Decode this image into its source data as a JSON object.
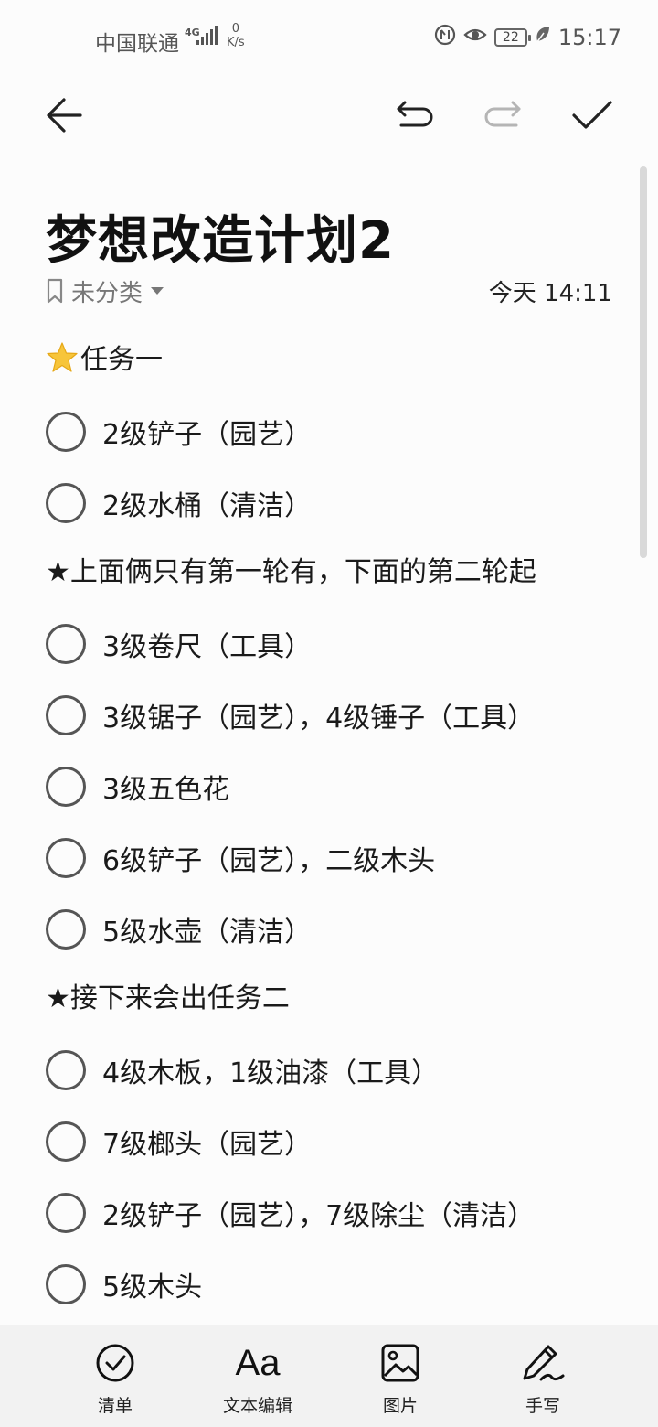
{
  "status_bar": {
    "carrier": "中国联通",
    "network_type": "4G",
    "speed_value": "0",
    "speed_unit": "K/s",
    "battery": "22",
    "time": "15:17",
    "icons": [
      "signal-icon",
      "nfc-icon",
      "eye-comfort-icon",
      "battery-icon",
      "leaf-icon"
    ]
  },
  "toolbar": {
    "icons": [
      "back-arrow-icon",
      "undo-icon",
      "redo-icon",
      "check-icon"
    ]
  },
  "note": {
    "title": "梦想改造计划2",
    "category": "未分类",
    "date": "今天 14:11",
    "heading1": "任务一",
    "items": [
      "2级铲子（园艺）",
      "2级水桶（清洁）",
      "3级卷尺（工具）",
      "3级锯子（园艺），4级锤子（工具）",
      "3级五色花",
      "6级铲子（园艺），二级木头",
      "5级水壶（清洁）",
      "4级木板，1级油漆（工具）",
      "7级榔头（园艺）",
      "2级铲子（园艺），7级除尘（清洁）",
      "5级木头"
    ],
    "note1": "★上面俩只有第一轮有，下面的第二轮起",
    "note2": "★接下来会出任务二"
  },
  "bottom_bar": {
    "items": [
      {
        "label": "清单",
        "icon": "checklist-icon"
      },
      {
        "label": "文本编辑",
        "icon_text": "Aa",
        "icon": "text-format-icon"
      },
      {
        "label": "图片",
        "icon": "image-icon"
      },
      {
        "label": "手写",
        "icon": "handwriting-icon"
      }
    ]
  },
  "colors": {
    "background": "#fcfcfc",
    "text": "#1a1a1a",
    "muted": "#777777",
    "bottom_bar": "#f2f2f2"
  }
}
